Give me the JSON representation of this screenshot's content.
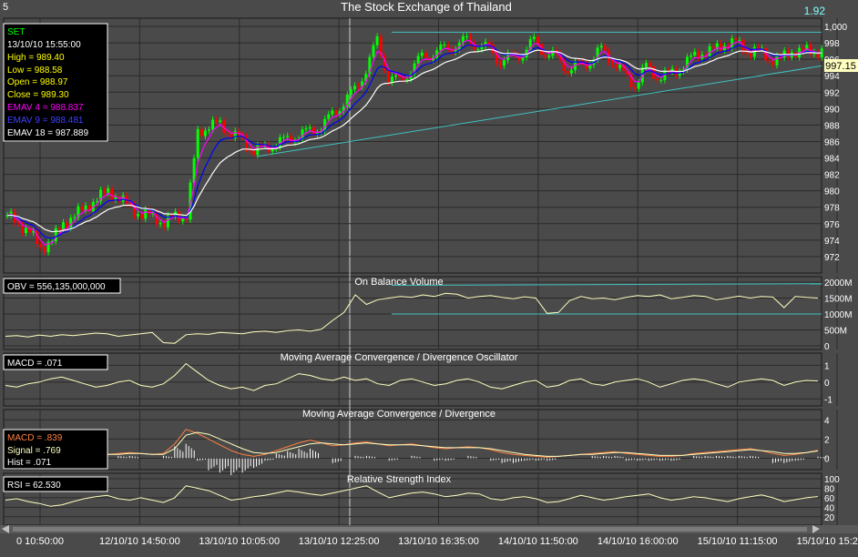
{
  "header": {
    "corner_left": "5",
    "title": "The Stock Exchange of Thailand",
    "corner_right": "1.92"
  },
  "info_box": {
    "symbol": "SET",
    "datetime": "13/10/10 15:55:00",
    "high": "High  = 989.40",
    "low": "Low   = 988.58",
    "open": "Open  = 988.97",
    "close": "Close = 989.30",
    "emav4": "EMAV 4 = 988.837",
    "emav9": "EMAV 9 = 988.481",
    "emav18": "EMAV 18 = 987.889"
  },
  "colors": {
    "background": "#4a4a4a",
    "grid": "#2a2a2a",
    "up_candle": "#00ff00",
    "down_candle": "#ff0000",
    "emav4": "#ff00ff",
    "emav9": "#0000ff",
    "emav18": "#ffffff",
    "indicator_line": "#ffffc0",
    "trend_line": "#40c0c0",
    "macd_line": "#ff8040",
    "signal_line": "#ffffc0"
  },
  "chart_data": [
    {
      "type": "candlestick",
      "title": "The Stock Exchange of Thailand",
      "ylim": [
        970,
        1001
      ],
      "y_ticks": [
        "972",
        "974",
        "976",
        "978",
        "980",
        "982",
        "984",
        "986",
        "988",
        "990",
        "992",
        "994",
        "996",
        "998",
        "1,000"
      ],
      "last_price_label": "997.15",
      "series": [
        {
          "name": "EMAV 4",
          "last": 988.837
        },
        {
          "name": "EMAV 9",
          "last": 988.481
        },
        {
          "name": "EMAV 18",
          "last": 987.889
        }
      ],
      "close_path": [
        977,
        976,
        975,
        973,
        974,
        976,
        977,
        978,
        979,
        980,
        979,
        978,
        977,
        977,
        976,
        977,
        977,
        987,
        988,
        988,
        987,
        986,
        985,
        985,
        986,
        986,
        987,
        987,
        988,
        989,
        991,
        992,
        995,
        998,
        994,
        993,
        995,
        996,
        997,
        997,
        998,
        998,
        998,
        997,
        996,
        996,
        997,
        998,
        997,
        996,
        995,
        995,
        996,
        997,
        996,
        994,
        993,
        995,
        994,
        994,
        995,
        996,
        997,
        997,
        998,
        998,
        997,
        997,
        996,
        996,
        997,
        997,
        997
      ]
    },
    {
      "type": "line",
      "title": "On Balance Volume",
      "value_label": "OBV = 556,135,000,000",
      "y_ticks": [
        "0",
        "500M",
        "1000M",
        "1500M",
        "2000M"
      ],
      "ylim": [
        0,
        2000
      ],
      "values": [
        300,
        320,
        280,
        340,
        300,
        350,
        320,
        360,
        400,
        380,
        300,
        340,
        380,
        420,
        100,
        80,
        350,
        380,
        360,
        420,
        400,
        380,
        440,
        460,
        420,
        480,
        500,
        460,
        520,
        800,
        1050,
        1600,
        1300,
        1450,
        1500,
        1550,
        1520,
        1600,
        1550,
        1650,
        1620,
        1500,
        1550,
        1580,
        1520,
        1480,
        1540,
        1500,
        1020,
        1050,
        1420,
        1550,
        1480,
        1500,
        1450,
        1520,
        1580,
        1550,
        1600,
        1480,
        1520,
        1580,
        1550,
        1450,
        1500,
        1560,
        1500,
        1550,
        1530,
        1200,
        1550,
        1520,
        1500
      ]
    },
    {
      "type": "line",
      "title": "Moving Average Convergence / Divergence Oscillator",
      "value_label": "MACD = .071",
      "y_ticks": [
        "-1",
        "0",
        "1"
      ],
      "ylim": [
        -1.2,
        1.4
      ],
      "values": [
        -0.2,
        -0.3,
        -0.1,
        0,
        0.2,
        0.3,
        0.1,
        -0.1,
        -0.3,
        -0.2,
        0,
        0.1,
        -0.2,
        -0.3,
        -0.1,
        0.4,
        1.1,
        0.6,
        0.1,
        -0.2,
        -0.4,
        -0.3,
        -0.5,
        -0.2,
        -0.1,
        0.2,
        0.5,
        0.4,
        0.2,
        0.1,
        0.3,
        0.1,
        0.2,
        -0.1,
        -0.2,
        0.1,
        0.2,
        0,
        -0.2,
        -0.1,
        0.1,
        0.2,
        0,
        -0.3,
        -0.4,
        -0.2,
        0,
        0.1,
        -0.3,
        -0.2,
        0.1,
        0.2,
        -0.1,
        -0.2,
        0,
        0.1,
        0.2,
        0,
        -0.3,
        -0.1,
        0.1,
        0.2,
        0.1,
        -0.1,
        -0.3,
        0,
        0.1,
        0.2,
        0.1,
        -0.2,
        0,
        0.1,
        0.07
      ]
    },
    {
      "type": "line",
      "title": "Moving Average Convergence / Divergence",
      "y_ticks": [
        "0",
        "2",
        "4"
      ],
      "ylim": [
        -0.8,
        4.5
      ],
      "series": [
        {
          "name": "MACD",
          "label": "MACD = .839",
          "values": [
            0.5,
            0.6,
            0.5,
            0.4,
            0.5,
            0.6,
            0.7,
            0.6,
            0.5,
            0.4,
            0.5,
            0.6,
            0.5,
            0.4,
            0.5,
            1.5,
            3.0,
            2.6,
            2.0,
            1.4,
            0.8,
            0.4,
            0.2,
            0.4,
            0.8,
            1.2,
            1.6,
            1.9,
            1.6,
            1.3,
            1.4,
            1.6,
            1.7,
            1.5,
            1.3,
            1.4,
            1.5,
            1.3,
            1.1,
            1.0,
            1.1,
            1.2,
            1.1,
            0.9,
            0.6,
            0.4,
            0.3,
            0.2,
            0.1,
            0.2,
            0.3,
            0.4,
            0.5,
            0.6,
            0.7,
            0.5,
            0.4,
            0.3,
            0.2,
            0.2,
            0.3,
            0.5,
            0.6,
            0.7,
            0.8,
            0.9,
            1.0,
            0.8,
            0.5,
            0.3,
            0.4,
            0.6,
            0.839
          ]
        },
        {
          "name": "Signal",
          "label": "Signal = .769",
          "values": [
            0.4,
            0.5,
            0.5,
            0.4,
            0.4,
            0.5,
            0.6,
            0.6,
            0.5,
            0.4,
            0.4,
            0.5,
            0.5,
            0.4,
            0.4,
            1.0,
            2.4,
            2.7,
            2.5,
            2.0,
            1.5,
            1.0,
            0.6,
            0.5,
            0.6,
            0.9,
            1.2,
            1.5,
            1.6,
            1.5,
            1.4,
            1.5,
            1.6,
            1.5,
            1.4,
            1.4,
            1.4,
            1.3,
            1.2,
            1.1,
            1.1,
            1.1,
            1.1,
            1.0,
            0.8,
            0.6,
            0.4,
            0.3,
            0.2,
            0.2,
            0.3,
            0.4,
            0.4,
            0.5,
            0.6,
            0.6,
            0.5,
            0.4,
            0.3,
            0.3,
            0.3,
            0.4,
            0.5,
            0.6,
            0.7,
            0.8,
            0.9,
            0.8,
            0.7,
            0.5,
            0.5,
            0.6,
            0.769
          ]
        },
        {
          "name": "Hist",
          "label": "Hist = .071"
        }
      ]
    },
    {
      "type": "line",
      "title": "Relative Strength Index",
      "value_label": "RSI = 62.530",
      "y_ticks": [
        "20",
        "40",
        "60",
        "80",
        "100"
      ],
      "ylim": [
        10,
        100
      ],
      "values": [
        55,
        58,
        52,
        48,
        42,
        45,
        52,
        58,
        62,
        65,
        58,
        55,
        60,
        55,
        50,
        60,
        85,
        80,
        75,
        65,
        55,
        58,
        62,
        65,
        70,
        75,
        72,
        68,
        65,
        70,
        75,
        80,
        85,
        72,
        60,
        65,
        70,
        72,
        68,
        62,
        65,
        70,
        68,
        58,
        55,
        60,
        62,
        58,
        50,
        52,
        58,
        65,
        60,
        55,
        58,
        62,
        65,
        68,
        60,
        55,
        58,
        62,
        60,
        56,
        52,
        58,
        62,
        66,
        60,
        52,
        56,
        60,
        62.53
      ]
    }
  ],
  "x_axis": {
    "labels": [
      "0 10:50:00",
      "12/10/10 14:50:00",
      "13/10/10 10:05:00",
      "13/10/10 12:25:00",
      "13/10/10 16:35:00",
      "14/10/10 11:50:00",
      "14/10/10 16:00:00",
      "15/10/10 11:15:00",
      "15/10/10 15:25:00"
    ]
  }
}
